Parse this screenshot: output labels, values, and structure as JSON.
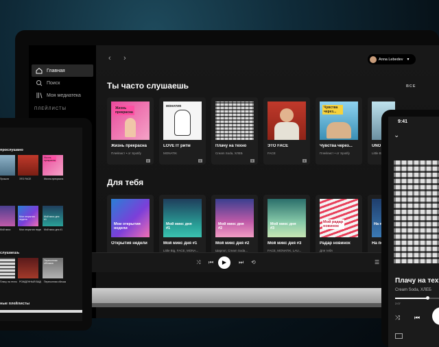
{
  "laptop": {
    "sidebar": {
      "items": [
        {
          "label": "Главная",
          "icon": "home-icon",
          "active": true
        },
        {
          "label": "Поиск",
          "icon": "search-icon",
          "active": false
        },
        {
          "label": "Моя медиатека",
          "icon": "library-icon",
          "active": false
        }
      ],
      "playlists_title": "ПЛЕЙЛИСТЫ"
    },
    "header": {
      "user_name": "Anna Lebedev",
      "back_glyph": "‹",
      "forward_glyph": "›",
      "dropdown_glyph": "▾"
    },
    "section1": {
      "title": "Ты часто слушаешь",
      "see_all": "ВСЕ",
      "cards": [
        {
          "title": "Жизнь прекрасна",
          "subtitle": "Плейлист • от Spotify",
          "art_text": "Жизнь прекрасна",
          "explicit": true
        },
        {
          "title": "LOVE IT ритм",
          "subtitle": "MONATIK",
          "art_text": "МОНАТИК",
          "explicit": true
        },
        {
          "title": "Плачу на техно",
          "subtitle": "Cream Soda, ХЛЕБ",
          "art_text": "",
          "explicit": true
        },
        {
          "title": "ЭТО FACE",
          "subtitle": "FACE",
          "art_text": "",
          "explicit": true
        },
        {
          "title": "Чувства через...",
          "subtitle": "Плейлист • от Spotify",
          "art_text": "Чувства через...",
          "explicit": false
        },
        {
          "title": "UNO",
          "subtitle": "Little Bi",
          "art_text": "",
          "explicit": false
        }
      ]
    },
    "section2": {
      "title": "Для тебя",
      "cards": [
        {
          "title": "Открытия недели",
          "subtitle": "",
          "art_text": "Мои открытия недели"
        },
        {
          "title": "Мой микс дня #1",
          "subtitle": "Little Big, FACE, MONA...",
          "art_text": "Мой микс дня #1"
        },
        {
          "title": "Мой микс дня #2",
          "subtitle": "Шарлот, Cream Soda...",
          "art_text": "Мой микс дня #2"
        },
        {
          "title": "Мой микс дня #3",
          "subtitle": "FACE, MONATIK, LAU...",
          "art_text": "Мой микс дня #3"
        },
        {
          "title": "Радар новинок",
          "subtitle": "Для тебя",
          "art_text": "Мой радар новинок"
        },
        {
          "title": "На по",
          "subtitle": "",
          "art_text": "На по"
        }
      ]
    },
    "player": {
      "heart": "♥",
      "shuffle": "⤨",
      "prev": "⏮",
      "play": "▶",
      "next": "⏭",
      "repeat": "⟲",
      "queue": "☰"
    }
  },
  "tablet": {
    "section1_title": "прослушано",
    "row1": [
      {
        "caption": "Прошли",
        "art_text": ""
      },
      {
        "caption": "ЭТО FACE",
        "art_text": ""
      },
      {
        "caption": "Жизнь прекрасна",
        "art_text": "Жизнь прекрасна"
      }
    ],
    "row2": [
      {
        "caption": "Мой микс",
        "art_text": ""
      },
      {
        "caption": "Мои открытия недели",
        "art_text": "Мои открытия недели"
      },
      {
        "caption": "Мой микс дня #1",
        "art_text": "Мой микс дня #1"
      }
    ],
    "section2_title": "слушаешь",
    "row3": [
      {
        "caption": "Плачу на техно",
        "art_text": ""
      },
      {
        "caption": "РОЖДЕННЫЙ ВАДО",
        "art_text": ""
      },
      {
        "caption": "Перекопная обложка",
        "art_text": "Перекопная обложка"
      }
    ],
    "section3_title": "ные плейлисты"
  },
  "phone": {
    "time": "9:41",
    "chevron": "⌄",
    "track_title": "Плачу на техно",
    "artist": "Cream Soda, ХЛЕБ",
    "elapsed": "2:07",
    "progress": 0.68,
    "shuffle": "⤨",
    "prev": "⏮"
  },
  "colors": {
    "accent": "#1db954",
    "bg": "#121212",
    "card": "#1e1e1e"
  }
}
